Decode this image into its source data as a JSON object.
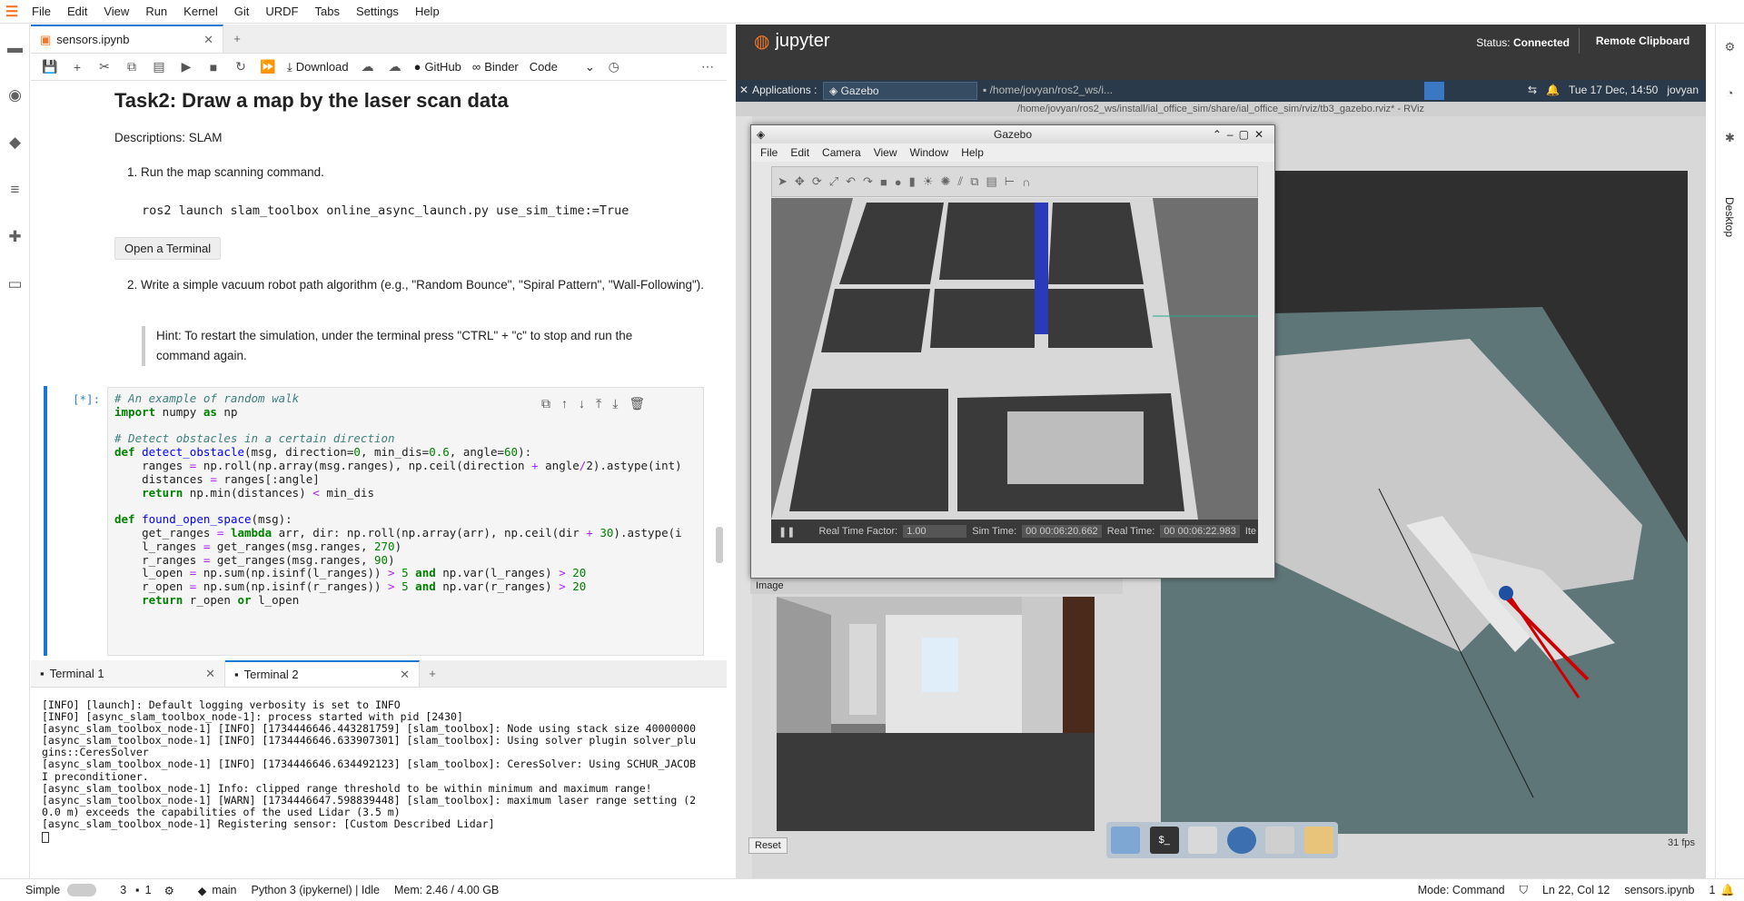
{
  "menubar": {
    "items": [
      "File",
      "Edit",
      "View",
      "Run",
      "Kernel",
      "Git",
      "URDF",
      "Tabs",
      "Settings",
      "Help"
    ]
  },
  "notebook": {
    "tab_title": "sensors.ipynb",
    "toolbar": {
      "download": "Download",
      "github": "GitHub",
      "binder": "Binder",
      "cell_type": "Code"
    },
    "heading": "Task2: Draw a map by the laser scan data",
    "descriptions": "Descriptions: SLAM",
    "step1": "Run the map scanning command.",
    "step1_cmd": "ros2 launch slam_toolbox online_async_launch.py use_sim_time:=True",
    "open_terminal": "Open a Terminal",
    "step2": "Write a simple vacuum robot path algorithm (e.g., \"Random Bounce\", \"Spiral Pattern\", \"Wall-Following\").",
    "hint": "Hint: To restart the simulation, under the terminal press \"CTRL\" + \"c\" to stop and run the command again.",
    "cell_prompt": "[*]:",
    "code": [
      {
        "t": "cm",
        "v": "# An example of random walk"
      },
      {
        "t": "mix",
        "v": [
          "import|kw",
          " numpy ",
          "as|kw",
          " np"
        ]
      },
      {
        "t": "blank",
        "v": ""
      },
      {
        "t": "cm",
        "v": "# Detect obstacles in a certain direction"
      },
      {
        "t": "mix",
        "v": [
          "def|kw",
          " ",
          "detect_obstacle|fn",
          "(msg, direction=",
          "0|nm",
          ", min_dis=",
          "0.6|nm",
          ", angle=",
          "60|nm",
          "):"
        ]
      },
      {
        "t": "mix",
        "v": [
          "    ranges ",
          "=|op",
          " np.roll(np.array(msg.ranges), np.ceil(direction ",
          "+|op",
          " angle",
          "/|op",
          "2",
          ").astype(int)"
        ]
      },
      {
        "t": "mix",
        "v": [
          "    distances ",
          "=|op",
          " ranges[:angle]"
        ]
      },
      {
        "t": "mix",
        "v": [
          "    ",
          "return|kw",
          " np.min(distances) ",
          "<|op",
          " min_dis"
        ]
      },
      {
        "t": "blank",
        "v": ""
      },
      {
        "t": "mix",
        "v": [
          "def|kw",
          " ",
          "found_open_space|fn",
          "(msg):"
        ]
      },
      {
        "t": "mix",
        "v": [
          "    get_ranges ",
          "=|op",
          " ",
          "lambda|kw",
          " arr, dir: np.roll(np.array(arr), np.ceil(dir ",
          "+|op",
          " ",
          "30|nm",
          ").astype(i"
        ]
      },
      {
        "t": "mix",
        "v": [
          "    l_ranges ",
          "=|op",
          " get_ranges(msg.ranges, ",
          "270|nm",
          ")"
        ]
      },
      {
        "t": "mix",
        "v": [
          "    r_ranges ",
          "=|op",
          " get_ranges(msg.ranges, ",
          "90|nm",
          ")"
        ]
      },
      {
        "t": "mix",
        "v": [
          "    l_open ",
          "=|op",
          " np.sum(np.isinf(l_ranges)) ",
          ">|op",
          " ",
          "5|nm",
          " ",
          "and|kw",
          " np.var(l_ranges) ",
          ">|op",
          " ",
          "20|nm"
        ]
      },
      {
        "t": "mix",
        "v": [
          "    r_open ",
          "=|op",
          " np.sum(np.isinf(r_ranges)) ",
          ">|op",
          " ",
          "5|nm",
          " ",
          "and|kw",
          " np.var(r_ranges) ",
          ">|op",
          " ",
          "20|nm"
        ]
      },
      {
        "t": "mix",
        "v": [
          "    ",
          "return|kw",
          " r_open ",
          "or|kw",
          " l_open"
        ]
      }
    ]
  },
  "terminals": {
    "tab1": "Terminal 1",
    "tab2": "Terminal 2",
    "lines": [
      "[INFO] [launch]: Default logging verbosity is set to INFO",
      "[INFO] [async_slam_toolbox_node-1]: process started with pid [2430]",
      "[async_slam_toolbox_node-1] [INFO] [1734446646.443281759] [slam_toolbox]: Node using stack size 40000000",
      "[async_slam_toolbox_node-1] [INFO] [1734446646.633907301] [slam_toolbox]: Using solver plugin solver_plu",
      "gins::CeresSolver",
      "[async_slam_toolbox_node-1] [INFO] [1734446646.634492123] [slam_toolbox]: CeresSolver: Using SCHUR_JACOB",
      "I preconditioner.",
      "[async_slam_toolbox_node-1] Info: clipped range threshold to be within minimum and maximum range!",
      "[async_slam_toolbox_node-1] [WARN] [1734446647.598839448] [slam_toolbox]: maximum laser range setting (2",
      "0.0 m) exceeds the capabilities of the used Lidar (3.5 m)",
      "[async_slam_toolbox_node-1] Registering sensor: [Custom Described Lidar]"
    ]
  },
  "statusbar": {
    "mode_label": "Simple",
    "kernels": "3",
    "terminals": "1",
    "branch": "main",
    "kernel": "Python 3 (ipykernel) | Idle",
    "mem": "Mem: 2.46 / 4.00 GB",
    "cmd_mode": "Mode: Command",
    "cursor": "Ln 22, Col 12",
    "file": "sensors.ipynb",
    "notifications": "1"
  },
  "desktop": {
    "jupyter_label": "jupyter",
    "status_label": "Status:",
    "status_value": "Connected",
    "remote_clipboard": "Remote Clipboard",
    "applications": "Applications :",
    "gazebo_task": "Gazebo",
    "path_task": "/home/jovyan/ros2_ws/i...",
    "clock": "Tue 17 Dec, 14:50",
    "user": "jovyan",
    "rviz_title": "/home/jovyan/ros2_ws/install/ial_office_sim/share/ial_office_sim/rviz/tb3_gazebo.rviz* - RViz",
    "image_panel": "Image",
    "reset": "Reset",
    "fps": "31 fps",
    "desktop_tab": "Desktop"
  },
  "gazebo": {
    "title": "Gazebo",
    "menu": [
      "File",
      "Edit",
      "Camera",
      "View",
      "Window",
      "Help"
    ],
    "rtf_label": "Real Time Factor:",
    "rtf_value": "1.00",
    "sim_label": "Sim Time:",
    "sim_value": "00 00:06:20.662",
    "real_label": "Real Time:",
    "real_value": "00 00:06:22.983",
    "iter_label": "Ite"
  }
}
